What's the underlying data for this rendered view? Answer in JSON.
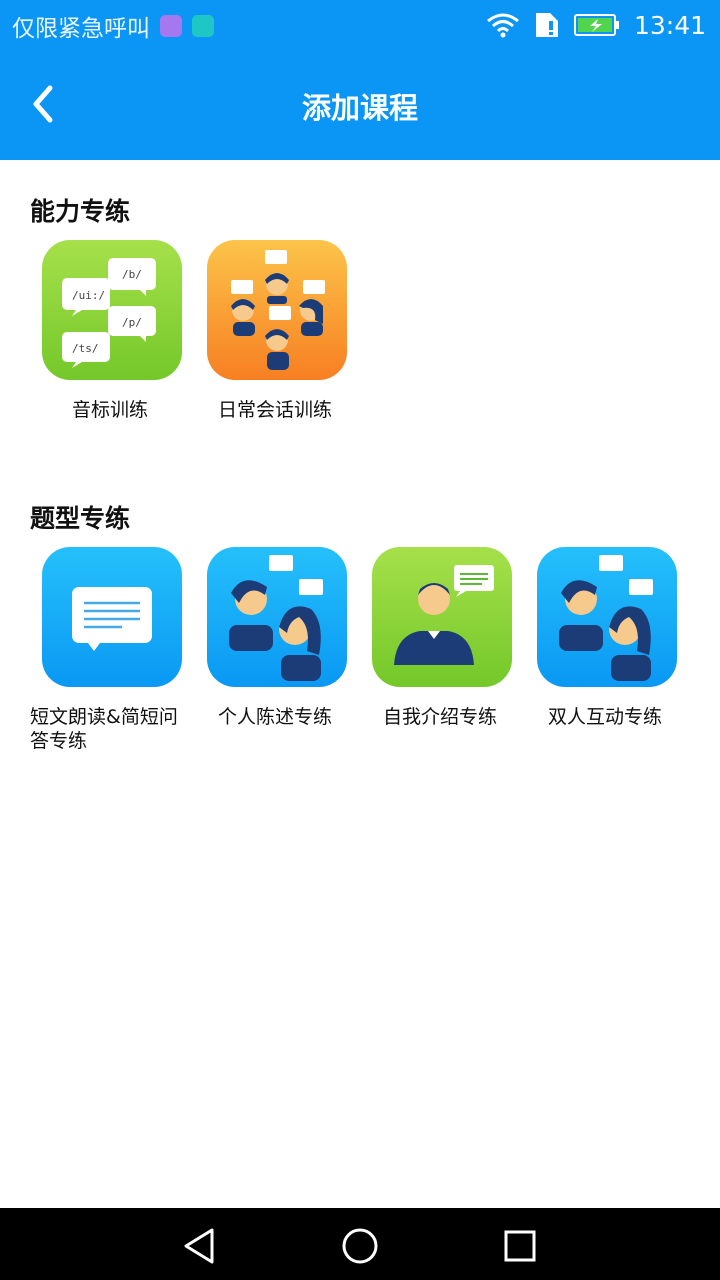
{
  "status_bar": {
    "carrier_text": "仅限紧急呼叫",
    "time": "13:41"
  },
  "header": {
    "title": "添加课程"
  },
  "sections": [
    {
      "title": "能力专练",
      "items": [
        {
          "label": "音标训练",
          "icon": "phonetic-bubbles-icon"
        },
        {
          "label": "日常会话训练",
          "icon": "conversation-group-icon"
        }
      ]
    },
    {
      "title": "题型专练",
      "items": [
        {
          "label": "短文朗读&简短问答专练",
          "icon": "message-bubble-icon"
        },
        {
          "label": "个人陈述专练",
          "icon": "two-people-talk-icon"
        },
        {
          "label": "自我介绍专练",
          "icon": "man-speaking-icon"
        },
        {
          "label": "双人互动专练",
          "icon": "two-people-interact-icon"
        }
      ]
    }
  ],
  "phonetic_tile": {
    "bubbles": [
      "/ui:/",
      "/b/",
      "/p/",
      "/ts/"
    ]
  },
  "colors": {
    "header_blue": "#0b96f5",
    "green_tile": "#8fd93a",
    "orange_tile": "#f99a2f",
    "blue_tile": "#12a8f7"
  }
}
